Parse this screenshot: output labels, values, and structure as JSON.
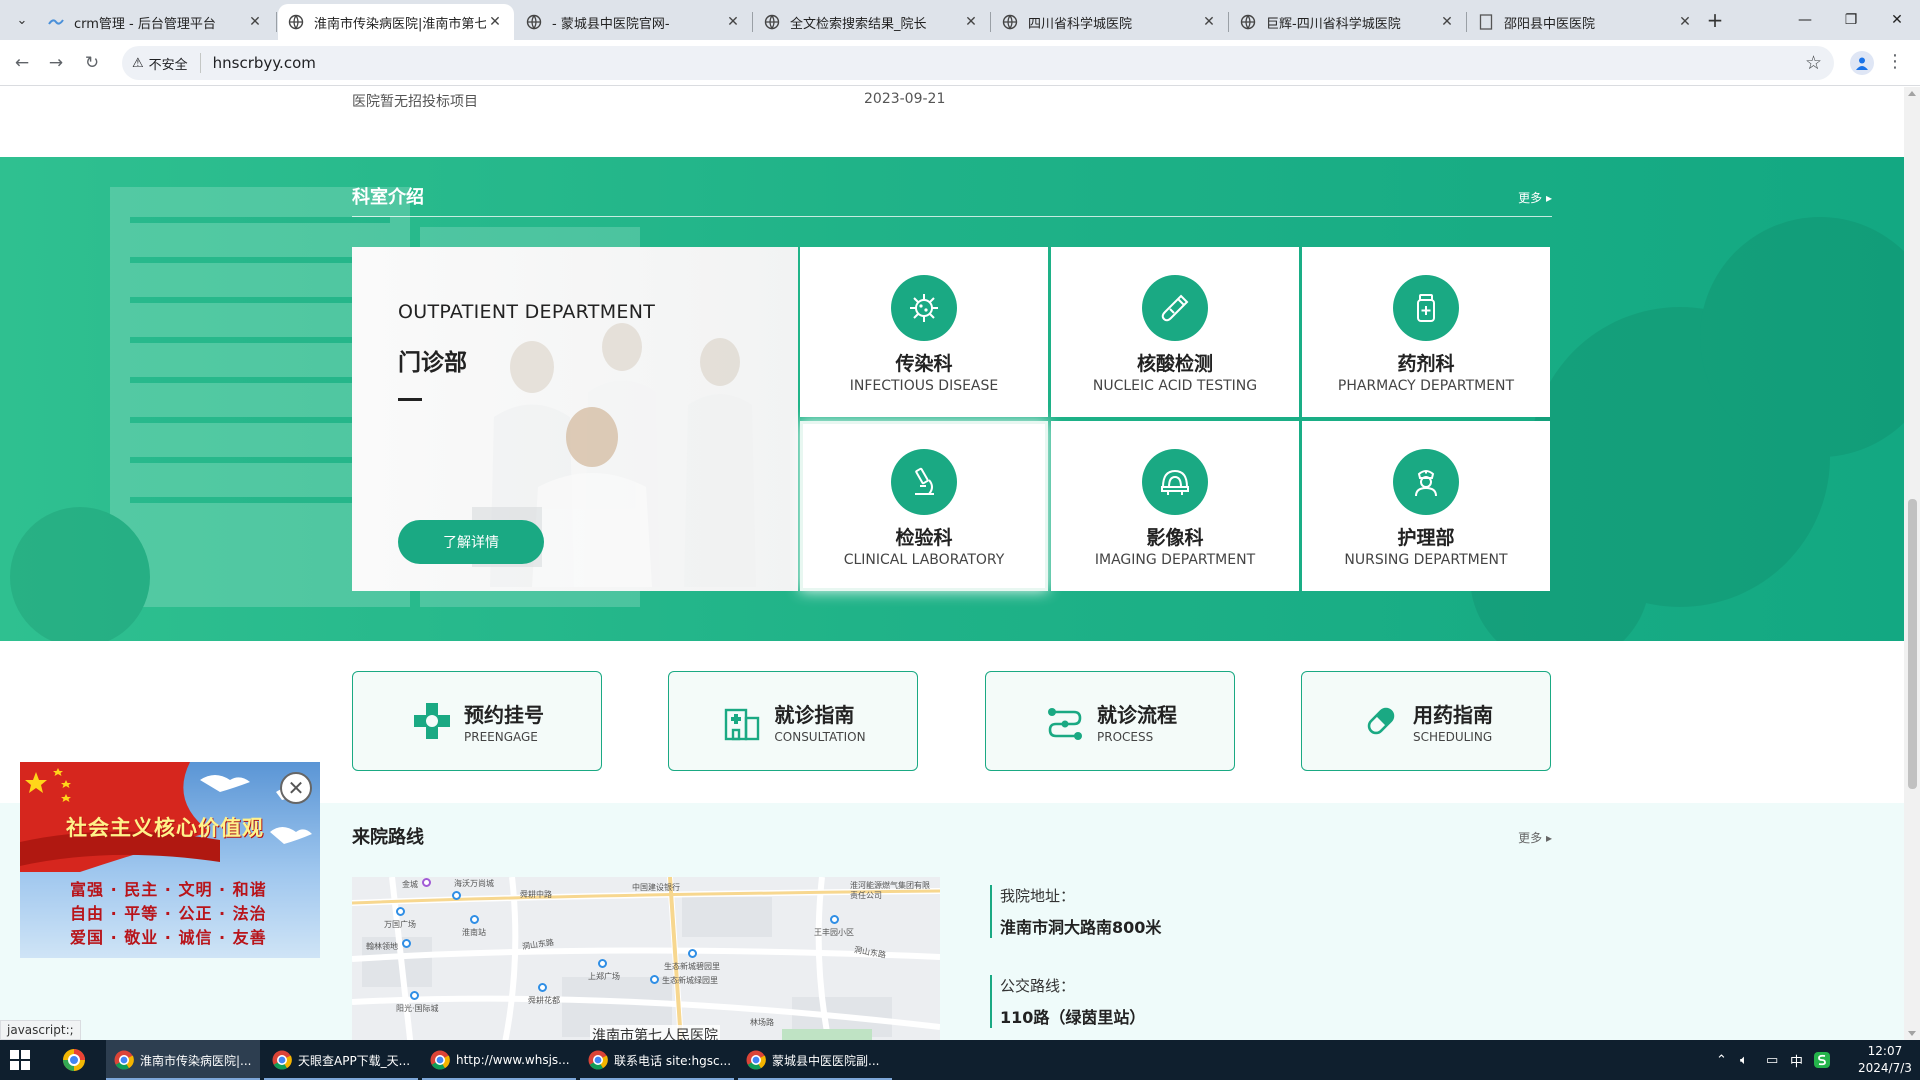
{
  "browser": {
    "tabs": [
      {
        "title": "crm管理 - 后台管理平台",
        "active": false
      },
      {
        "title": "淮南市传染病医院|淮南市第七人民医院",
        "active": true
      },
      {
        "title": "- 蒙城县中医院官网-",
        "active": false
      },
      {
        "title": "全文检索搜索结果_院长",
        "active": false
      },
      {
        "title": "四川省科学城医院",
        "active": false
      },
      {
        "title": "巨辉-四川省科学城医院",
        "active": false
      },
      {
        "title": "邵阳县中医医院",
        "active": false
      }
    ],
    "security_label": "不安全",
    "url": "hnscrbyy.com",
    "status_text": "javascript:;"
  },
  "tender": {
    "title": "医院暂无招投标项目",
    "date": "2023-09-21"
  },
  "departments": {
    "section_title": "科室介绍",
    "more_label": "更多",
    "feature": {
      "en": "OUTPATIENT DEPARTMENT",
      "cn": "门诊部",
      "button": "了解详情"
    },
    "cards": [
      {
        "cn": "传染科",
        "en": "INFECTIOUS DISEASE",
        "icon": "virus-icon"
      },
      {
        "cn": "核酸检测",
        "en": "NUCLEIC ACID TESTING",
        "icon": "test-tube-icon"
      },
      {
        "cn": "药剂科",
        "en": "PHARMACY DEPARTMENT",
        "icon": "medicine-bottle-icon"
      },
      {
        "cn": "检验科",
        "en": "CLINICAL LABORATORY",
        "icon": "microscope-icon"
      },
      {
        "cn": "影像科",
        "en": "IMAGING DEPARTMENT",
        "icon": "ct-scanner-icon"
      },
      {
        "cn": "护理部",
        "en": "NURSING DEPARTMENT",
        "icon": "nurse-icon"
      }
    ]
  },
  "quick_links": [
    {
      "cn": "预约挂号",
      "en": "PREENGAGE",
      "icon": "medical-cross-icon"
    },
    {
      "cn": "就诊指南",
      "en": "CONSULTATION",
      "icon": "hospital-icon"
    },
    {
      "cn": "就诊流程",
      "en": "PROCESS",
      "icon": "process-icon"
    },
    {
      "cn": "用药指南",
      "en": "SCHEDULING",
      "icon": "pill-icon"
    }
  ],
  "route": {
    "section_title": "来院路线",
    "more_label": "更多",
    "map_caption": "淮南市第七人民医院",
    "map_labels": [
      "金城",
      "海沃万尚城",
      "舜耕中路",
      "中国建设银行",
      "淮河能源燃气集团有限责任公司",
      "万国广场",
      "淮南站",
      "翰林领地",
      "洞山东路",
      "洞山东路",
      "王丰园小区",
      "上郑广场",
      "生态新城碧园里",
      "生态新城绿园里",
      "舜耕花都",
      "阳光·国际城",
      "林场路"
    ],
    "address_label": "我院地址：",
    "address_value": "淮南市洞大路南800米",
    "bus_label": "公交路线：",
    "bus_value": "110路（绿茵里站）"
  },
  "float_ad": {
    "title": "社会主义核心价值观",
    "lines": [
      "富强 · 民主 · 文明 · 和谐",
      "自由 · 平等 · 公正 · 法治",
      "爱国 · 敬业 · 诚信 · 友善"
    ]
  },
  "taskbar": {
    "items": [
      {
        "label": "淮南市传染病医院|...",
        "active": true
      },
      {
        "label": "天眼查APP下载_天...",
        "active": false
      },
      {
        "label": "http://www.whsjs...",
        "active": false
      },
      {
        "label": "联系电话 site:hgsc...",
        "active": false
      },
      {
        "label": "蒙城县中医医院副...",
        "active": false
      }
    ],
    "ime": "中",
    "time": "12:07",
    "date": "2024/7/3"
  },
  "colors": {
    "accent": "#1aa983",
    "section_bg": "#20b388"
  }
}
